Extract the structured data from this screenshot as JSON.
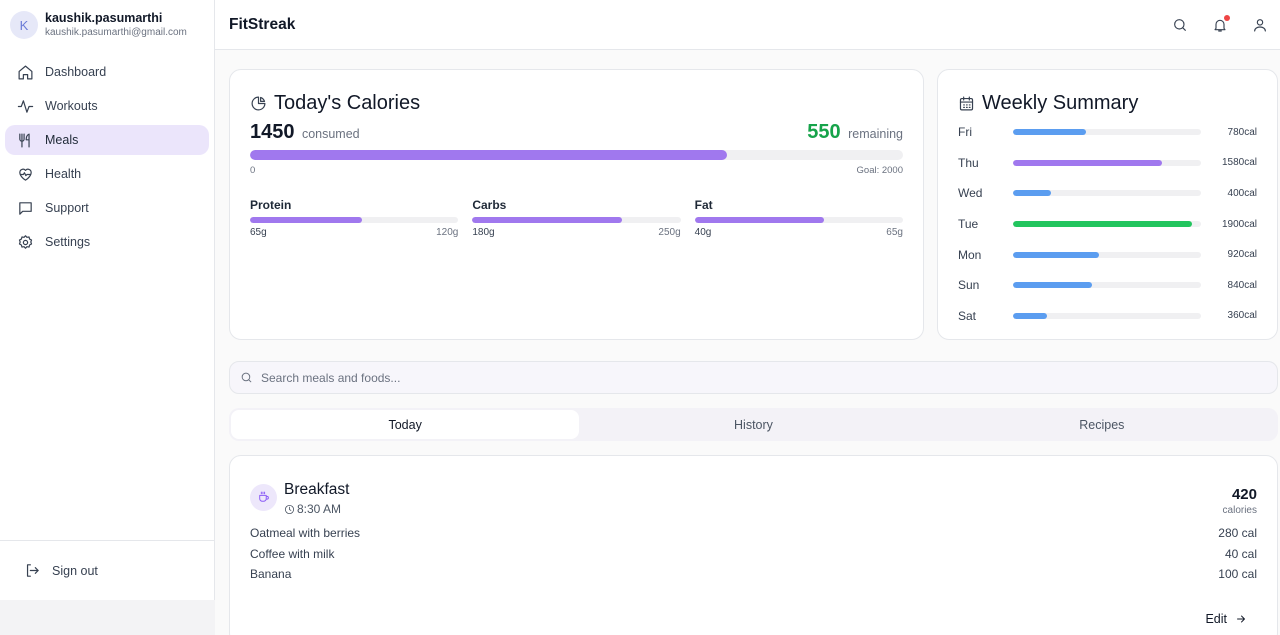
{
  "user": {
    "initial": "K",
    "name": "kaushik.pasumarthi",
    "email": "kaushik.pasumarthi@gmail.com"
  },
  "nav": [
    {
      "label": "Dashboard",
      "icon": "home-icon"
    },
    {
      "label": "Workouts",
      "icon": "activity-icon"
    },
    {
      "label": "Meals",
      "icon": "utensils-icon",
      "active": true
    },
    {
      "label": "Health",
      "icon": "heart-pulse-icon"
    },
    {
      "label": "Support",
      "icon": "message-square-icon"
    },
    {
      "label": "Settings",
      "icon": "gear-icon"
    }
  ],
  "sign_out": "Sign out",
  "header": {
    "title": "FitStreak",
    "icons": [
      "search-icon",
      "bell-icon",
      "user-icon"
    ]
  },
  "colors": {
    "accent": "#a078ee",
    "blue": "#5b9df0",
    "green": "#22c55e",
    "remaining": "#16a34a",
    "active_nav": "#ebe5fb"
  },
  "calories": {
    "title": "Today's Calories",
    "consumed": "1450",
    "consumed_label": "consumed",
    "remaining": "550",
    "remaining_label": "remaining",
    "progress": 0.73,
    "scale_min": "0",
    "goal": "Goal: 2000",
    "macros": [
      {
        "name": "Protein",
        "value": "65g",
        "goal": "120g",
        "progress": 0.54
      },
      {
        "name": "Carbs",
        "value": "180g",
        "goal": "250g",
        "progress": 0.72
      },
      {
        "name": "Fat",
        "value": "40g",
        "goal": "65g",
        "progress": 0.62
      }
    ]
  },
  "weekly": {
    "title": "Weekly Summary",
    "days": [
      {
        "day": "Fri",
        "value": "780cal",
        "progress": 0.39,
        "color": "blue"
      },
      {
        "day": "Thu",
        "value": "1580cal",
        "progress": 0.79,
        "color": "accent"
      },
      {
        "day": "Wed",
        "value": "400cal",
        "progress": 0.2,
        "color": "blue"
      },
      {
        "day": "Tue",
        "value": "1900cal",
        "progress": 0.95,
        "color": "green"
      },
      {
        "day": "Mon",
        "value": "920cal",
        "progress": 0.46,
        "color": "blue"
      },
      {
        "day": "Sun",
        "value": "840cal",
        "progress": 0.42,
        "color": "blue"
      },
      {
        "day": "Sat",
        "value": "360cal",
        "progress": 0.18,
        "color": "blue"
      }
    ]
  },
  "search": {
    "placeholder": "Search meals and foods..."
  },
  "tabs": [
    {
      "label": "Today",
      "active": true
    },
    {
      "label": "History"
    },
    {
      "label": "Recipes"
    }
  ],
  "meal": {
    "name": "Breakfast",
    "time": "8:30 AM",
    "total": "420",
    "total_label": "calories",
    "foods": [
      {
        "name": "Oatmeal with berries",
        "cal": "280 cal"
      },
      {
        "name": "Coffee with milk",
        "cal": "40 cal"
      },
      {
        "name": "Banana",
        "cal": "100 cal"
      }
    ],
    "edit_label": "Edit"
  }
}
